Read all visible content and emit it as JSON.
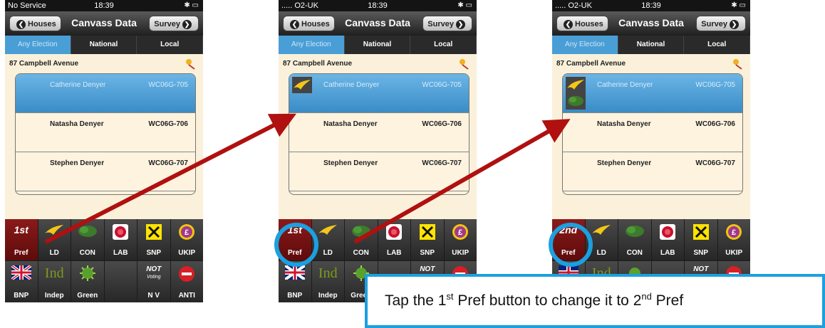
{
  "phones": [
    {
      "status": {
        "carrier": "No Service",
        "time": "18:39"
      },
      "nav": {
        "back": "Houses",
        "title": "Canvass Data",
        "forward": "Survey"
      },
      "tabs": [
        "Any Election",
        "National",
        "Local"
      ],
      "address": "87 Campbell Avenue",
      "voters": [
        {
          "name": "Catherine Denyer",
          "id": "WC06G-705"
        },
        {
          "name": "Natasha Denyer",
          "id": "WC06G-706"
        },
        {
          "name": "Stephen Denyer",
          "id": "WC06G-707"
        }
      ],
      "pref": {
        "ordinal": "1st",
        "label": "Pref"
      }
    },
    {
      "status": {
        "carrier": "..... O2-UK",
        "time": "18:39"
      },
      "nav": {
        "back": "Houses",
        "title": "Canvass Data",
        "forward": "Survey"
      },
      "tabs": [
        "Any Election",
        "National",
        "Local"
      ],
      "address": "87 Campbell Avenue",
      "voters": [
        {
          "name": "Catherine Denyer",
          "id": "WC06G-705"
        },
        {
          "name": "Natasha Denyer",
          "id": "WC06G-706"
        },
        {
          "name": "Stephen Denyer",
          "id": "WC06G-707"
        }
      ],
      "pref": {
        "ordinal": "1st",
        "label": "Pref"
      }
    },
    {
      "status": {
        "carrier": "..... O2-UK",
        "time": "18:39"
      },
      "nav": {
        "back": "Houses",
        "title": "Canvass Data",
        "forward": "Survey"
      },
      "tabs": [
        "Any Election",
        "National",
        "Local"
      ],
      "address": "87 Campbell Avenue",
      "voters": [
        {
          "name": "Catherine Denyer",
          "id": "WC06G-705"
        },
        {
          "name": "Natasha Denyer",
          "id": "WC06G-706"
        },
        {
          "name": "Stephen Denyer",
          "id": "WC06G-707"
        }
      ],
      "pref": {
        "ordinal": "2nd",
        "label": "Pref"
      }
    }
  ],
  "parties": {
    "ld": "LD",
    "con": "CON",
    "lab": "LAB",
    "snp": "SNP",
    "ukip": "UKIP",
    "bnp": "BNP",
    "indep": "Indep",
    "indep_logo": "Ind",
    "green": "Green",
    "not_voting_top": "NOT",
    "not_voting_small": "Voting",
    "nv": "N V",
    "anti": "ANTI"
  },
  "callout": {
    "prefix": "Tap the 1",
    "sup1": "st",
    "middle": " Pref button to change it to 2",
    "sup2": "nd",
    "suffix": " Pref"
  },
  "colors": {
    "accent": "#1ba0e0",
    "arrow": "#b01010",
    "selected": "#4a9ed6",
    "pref_active": "#7a1414"
  }
}
